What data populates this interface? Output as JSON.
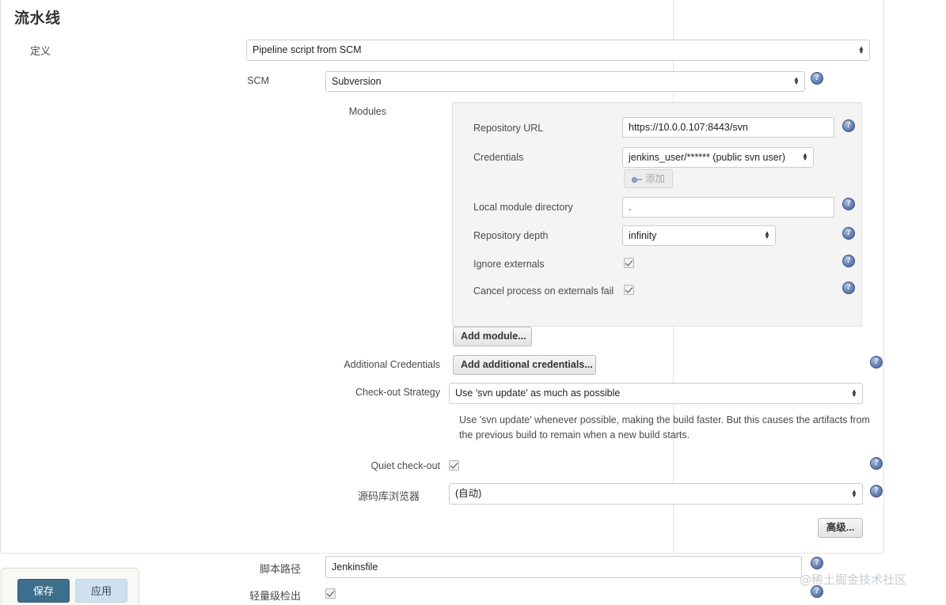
{
  "page": {
    "title": "流水线",
    "watermark": "@稀土掘金技术社区"
  },
  "definition": {
    "label": "定义",
    "value": "Pipeline script from SCM"
  },
  "scm": {
    "label": "SCM",
    "value": "Subversion"
  },
  "modules": {
    "label": "Modules",
    "repository_url": {
      "label": "Repository URL",
      "value": "https://10.0.0.107:8443/svn"
    },
    "credentials": {
      "label": "Credentials",
      "value": "jenkins_user/****** (public svn user)",
      "add_button": "添加"
    },
    "local_module_directory": {
      "label": "Local module directory",
      "value": "."
    },
    "repository_depth": {
      "label": "Repository depth",
      "value": "infinity"
    },
    "ignore_externals": {
      "label": "Ignore externals",
      "checked": true
    },
    "cancel_process_on_externals_fail": {
      "label": "Cancel process on externals fail",
      "checked": true
    },
    "add_module_button": "Add module..."
  },
  "additional_credentials": {
    "label": "Additional Credentials",
    "button": "Add additional credentials..."
  },
  "checkout_strategy": {
    "label": "Check-out Strategy",
    "value": "Use 'svn update' as much as possible",
    "description": "Use 'svn update' whenever possible, making the build faster. But this causes the artifacts from the previous build to remain when a new build starts."
  },
  "quiet_checkout": {
    "label": "Quiet check-out",
    "checked": true
  },
  "repository_browser": {
    "label": "源码库浏览器",
    "value": "(自动)"
  },
  "advanced_button": "高级...",
  "script_path": {
    "label": "脚本路径",
    "value": "Jenkinsfile"
  },
  "lightweight_checkout": {
    "label": "轻量级检出",
    "checked": true
  },
  "footer": {
    "save_label": "保存",
    "apply_label": "应用"
  },
  "icons": {
    "help": "?",
    "select_up": "▲",
    "select_down": "▼"
  },
  "colors": {
    "save_button": "#3d6e8c",
    "apply_button": "#cfe0ef",
    "help_icon": "#41598e",
    "module_panel": "#f4f4f4"
  }
}
